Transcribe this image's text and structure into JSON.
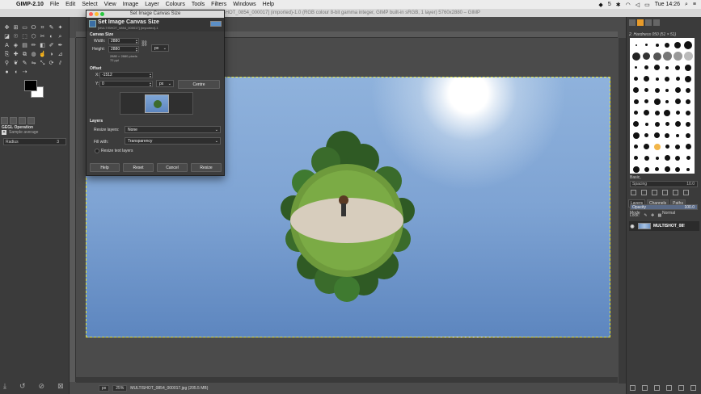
{
  "menubar": {
    "app_name": "GIMP-2.10",
    "items": [
      "File",
      "Edit",
      "Select",
      "View",
      "Image",
      "Layer",
      "Colours",
      "Tools",
      "Filters",
      "Windows",
      "Help"
    ],
    "clock": "Tue 14:26",
    "battery_label": "5"
  },
  "window": {
    "title": "[SHOT_0854_000017] (imported)-1.0 (RGB colour 8-bit gamma integer, GIMP built-in sRGB, 1 layer) 5760x2880 – GIMP"
  },
  "toolbox": {
    "gegl_title": "GEGL Operation",
    "gegl_operation": "Sample average",
    "radius_label": "Radius",
    "radius_value": "3"
  },
  "dialog": {
    "window_title": "Set Image Canvas Size",
    "heading": "Set Image Canvas Size",
    "subheading": "[MULTISHOT_0854_000017] (imported)-1",
    "canvas_size_section": "Canvas Size",
    "width_label": "Width:",
    "width_value": "2880",
    "height_label": "Height:",
    "height_value": "2880",
    "size_note": "2880 × 2880 pixels",
    "ppi_note": "72 ppi",
    "unit": "px",
    "offset_section": "Offset",
    "x_label": "X:",
    "x_value": "-1512",
    "y_label": "Y:",
    "y_value": "0",
    "offset_unit": "px",
    "centre_button": "Centre",
    "layers_section": "Layers",
    "resize_layers_label": "Resize layers:",
    "resize_layers_value": "None",
    "fill_with_label": "Fill with:",
    "fill_with_value": "Transparency",
    "resize_text_layers": "Resize text layers",
    "buttons": {
      "help": "Help",
      "reset": "Reset",
      "cancel": "Cancel",
      "resize": "Resize"
    }
  },
  "status": {
    "unit": "px",
    "zoom": "25%",
    "file_info": "MULTISHOT_0854_000017.jpg (205.5 MB)"
  },
  "dock": {
    "brush_name": "2. Hardness 050 (51 × 51)",
    "brush_category": "Basic,",
    "spacing_label": "Spacing",
    "spacing_value": "10.0",
    "tabs": [
      "Layers",
      "Channels",
      "Paths"
    ],
    "mode_label": "Mode",
    "mode_value": "Normal",
    "opacity_label": "Opacity",
    "opacity_value": "100.0",
    "lock_label": "Lock:",
    "layer_name": "MULTISHOT_08!"
  }
}
